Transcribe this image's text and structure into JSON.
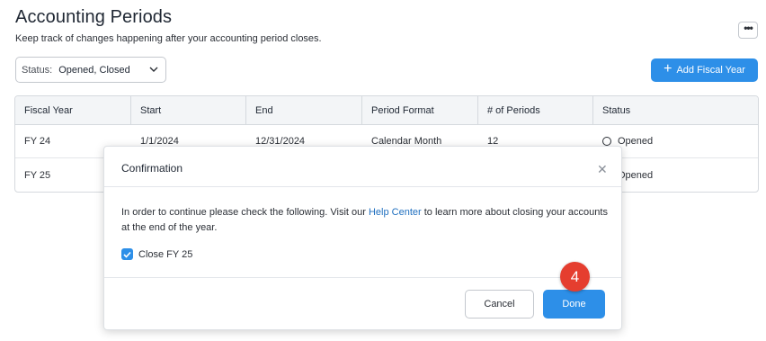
{
  "page": {
    "title": "Accounting Periods",
    "subtitle": "Keep track of changes happening after your accounting period closes."
  },
  "header": {
    "more_icon": "ellipsis-icon",
    "more_label": "•••"
  },
  "filter": {
    "label": "Status:",
    "value": "Opened, Closed"
  },
  "actions": {
    "add_fiscal_year_label": "Add Fiscal Year",
    "add_icon": "plus-icon"
  },
  "table": {
    "columns": [
      "Fiscal Year",
      "Start",
      "End",
      "Period Format",
      "# of Periods",
      "Status"
    ],
    "rows": [
      {
        "fiscal_year": "FY 24",
        "start": "1/1/2024",
        "end": "12/31/2024",
        "period_format": "Calendar Month",
        "num_periods": "12",
        "status": "Opened"
      },
      {
        "fiscal_year": "FY 25",
        "start": "",
        "end": "",
        "period_format": "",
        "num_periods": "",
        "status": "Opened"
      }
    ]
  },
  "modal": {
    "title": "Confirmation",
    "body_before_link": "In order to continue please check the following. Visit our ",
    "link_text": "Help Center",
    "body_after_link": " to learn more about closing your accounts at the end of the year.",
    "checkbox_label": "Close FY 25",
    "checkbox_checked": true,
    "cancel_label": "Cancel",
    "done_label": "Done"
  },
  "annotation": {
    "step_number": "4"
  },
  "colors": {
    "primary": "#2d8fe8",
    "link": "#1f6fbf",
    "badge": "#e53e2f"
  }
}
